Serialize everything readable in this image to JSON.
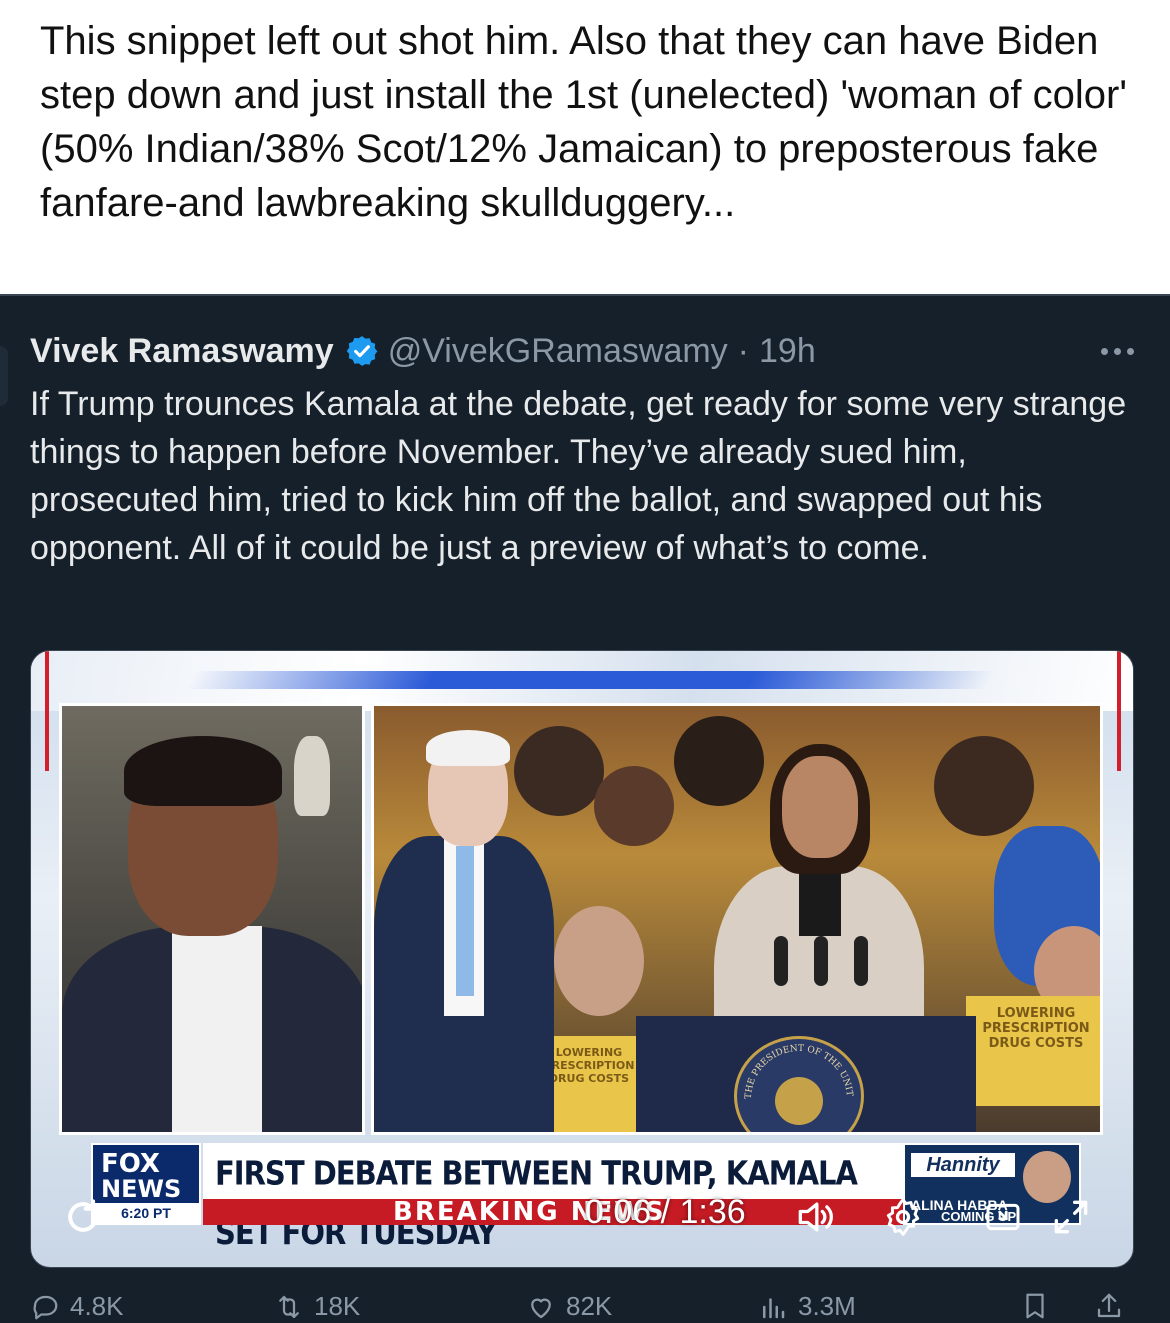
{
  "outer_post": {
    "text": "This snippet left out shot him. Also that they can have Biden step down and just install the 1st (unelected) 'woman of color' (50% Indian/38% Scot/12% Jamaican) to preposterous fake fanfare-and lawbreaking skullduggery..."
  },
  "tweet": {
    "author_name": "Vivek Ramaswamy",
    "handle": "@VivekGRamaswamy",
    "separator": "·",
    "time": "19h",
    "body": "If Trump trounces Kamala at the debate, get ready for some very strange things to happen before November. They’ve already sued him, prosecuted him, tried to kick him off the ballot, and swapped out his opponent. All of it could be just a preview of what’s to come."
  },
  "video": {
    "fox_logo_top": "FOX",
    "fox_logo_bottom": "NEWS",
    "fox_time": "6:20 PT",
    "headline": "FIRST DEBATE BETWEEN TRUMP, KAMALA SET FOR TUESDAY",
    "breaking": "BREAKING NEWS",
    "show_logo": "Hannity",
    "show_sub1": "ALINA HABBA",
    "show_sub2": "COMING UP",
    "podium_seal_text": "THE PRESIDENT OF THE UNITED",
    "sign_left": "LOWERING PRESCRIPTION DRUG COSTS",
    "sign_right": "LOWERING PRESCRIPTION DRUG COSTS",
    "time_display": "0:06 / 1:36"
  },
  "actions": {
    "reply_count": "4.8K",
    "retweet_count": "18K",
    "like_count": "82K",
    "views_count": "3.3M"
  },
  "colors": {
    "embed_bg": "#15202b",
    "text_primary": "#e7e9ea",
    "text_secondary": "#8b98a5",
    "verified_blue": "#1d9bf0",
    "fox_blue": "#0b2a6b",
    "breaking_red": "#c61b24"
  },
  "icons": {
    "verified": "verified-badge-icon",
    "more": "more-dots-icon",
    "replay": "replay-icon",
    "volume": "volume-icon",
    "settings": "gear-icon",
    "pip": "picture-in-picture-icon",
    "fullscreen": "fullscreen-icon",
    "reply": "reply-icon",
    "retweet": "retweet-icon",
    "like": "heart-icon",
    "views": "views-icon",
    "bookmark": "bookmark-icon",
    "share": "share-icon"
  }
}
